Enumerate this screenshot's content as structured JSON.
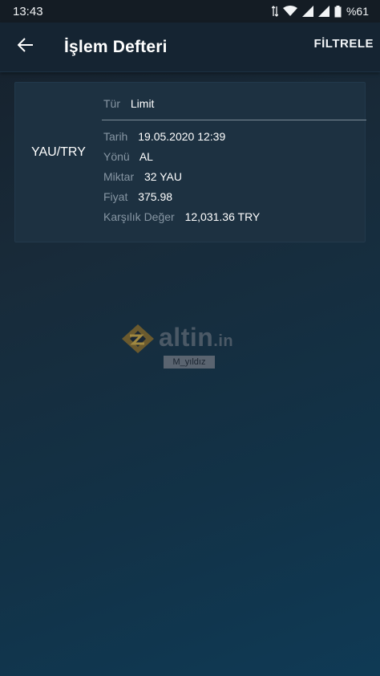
{
  "status_bar": {
    "time": "13:43",
    "battery": "%61"
  },
  "app_bar": {
    "title": "İşlem Defteri",
    "filter_label": "FİLTRELE"
  },
  "trade": {
    "pair": "YAU/TRY",
    "type_key": "Tür",
    "type_value": "Limit",
    "rows": [
      {
        "key": "Tarih",
        "value": "19.05.2020 12:39"
      },
      {
        "key": "Yönü",
        "value": "AL"
      },
      {
        "key": "Miktar",
        "value": "32 YAU"
      },
      {
        "key": "Fiyat",
        "value": "375.98"
      },
      {
        "key": "Karşılık Değer",
        "value": "12,031.36 TRY"
      }
    ]
  },
  "watermark": {
    "brand": "altin",
    "suffix": ".in",
    "user": "M_yıldız"
  },
  "icons": [
    "back-arrow-icon",
    "wifi-icon",
    "signal-icon",
    "battery-icon",
    "watermark-logo-icon"
  ]
}
